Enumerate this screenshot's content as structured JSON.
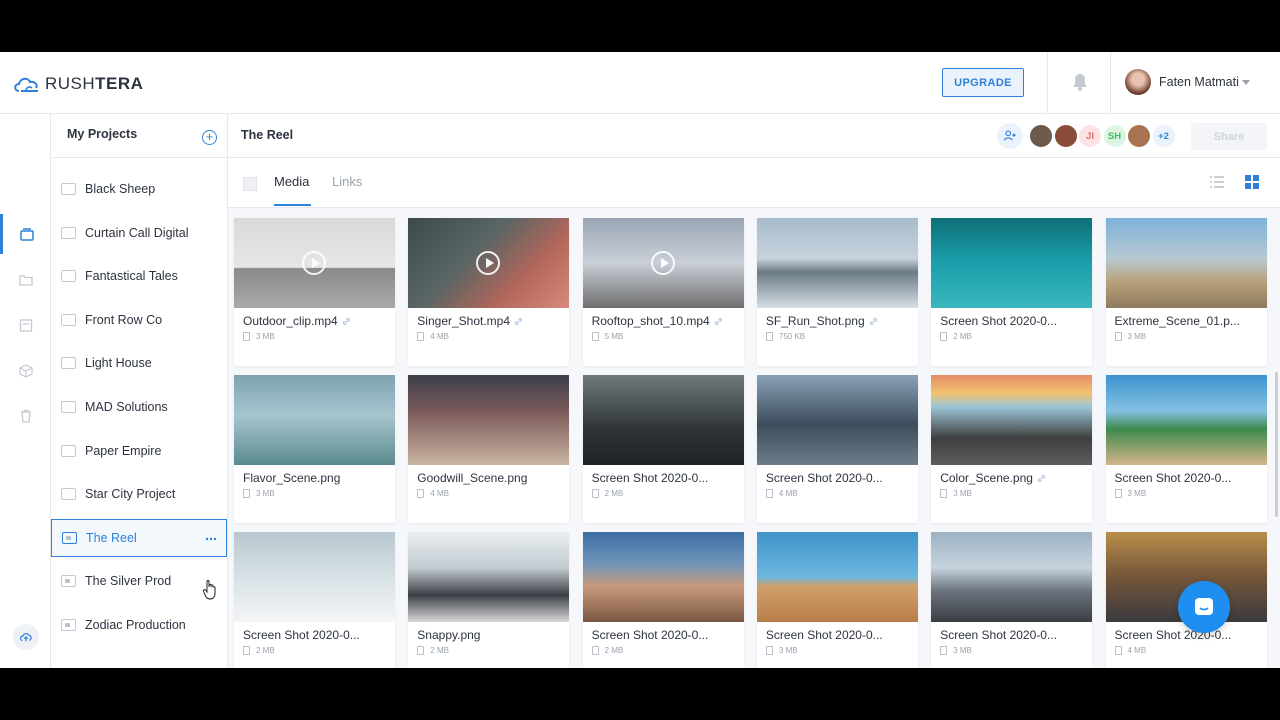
{
  "brand": {
    "name_light": "RUSH",
    "name_bold": "TERA"
  },
  "header": {
    "upgrade_label": "UPGRADE",
    "user_name": "Faten Matmati"
  },
  "projects": {
    "title": "My Projects",
    "items": [
      {
        "label": "Black Sheep",
        "shared": false
      },
      {
        "label": "Curtain Call Digital",
        "shared": false
      },
      {
        "label": "Fantastical Tales",
        "shared": false
      },
      {
        "label": "Front Row Co",
        "shared": false
      },
      {
        "label": "Light House",
        "shared": false
      },
      {
        "label": "MAD Solutions",
        "shared": false
      },
      {
        "label": "Paper Empire",
        "shared": false
      },
      {
        "label": "Star City Project",
        "shared": false
      },
      {
        "label": "The Reel",
        "shared": true
      },
      {
        "label": "The Silver Prod",
        "shared": true
      },
      {
        "label": "Zodiac Production",
        "shared": true
      }
    ],
    "active_index": 8
  },
  "main": {
    "title": "The Reel",
    "collaborators": [
      {
        "initials": "",
        "color": "#6d5a4b"
      },
      {
        "initials": "",
        "color": "#8b4b3a"
      },
      {
        "initials": "JI",
        "color": "#fde2e2",
        "text": "#e66b6b"
      },
      {
        "initials": "SH",
        "color": "#dff5e4",
        "text": "#3dbb62"
      },
      {
        "initials": "",
        "color": "#a8734f"
      },
      {
        "initials": "+2",
        "color": "#eaf3fc",
        "text": "#2f80d9"
      }
    ],
    "share_label": "Share",
    "tabs": [
      {
        "label": "Media"
      },
      {
        "label": "Links"
      }
    ]
  },
  "files": [
    {
      "name": "Outdoor_clip.mp4",
      "size": "3 MB",
      "video": true,
      "link": true
    },
    {
      "name": "Singer_Shot.mp4",
      "size": "4 MB",
      "video": true,
      "link": true
    },
    {
      "name": "Rooftop_shot_10.mp4",
      "size": "5 MB",
      "video": true,
      "link": true
    },
    {
      "name": "SF_Run_Shot.png",
      "size": "750 KB",
      "video": false,
      "link": true
    },
    {
      "name": "Screen Shot 2020-0...",
      "size": "2 MB",
      "video": false,
      "link": false
    },
    {
      "name": "Extreme_Scene_01.p...",
      "size": "3 MB",
      "video": false,
      "link": false
    },
    {
      "name": "Flavor_Scene.png",
      "size": "3 MB",
      "video": false,
      "link": false
    },
    {
      "name": "Goodwill_Scene.png",
      "size": "4 MB",
      "video": false,
      "link": false
    },
    {
      "name": "Screen Shot 2020-0...",
      "size": "2 MB",
      "video": false,
      "link": false
    },
    {
      "name": "Screen Shot 2020-0...",
      "size": "4 MB",
      "video": false,
      "link": false
    },
    {
      "name": "Color_Scene.png",
      "size": "3 MB",
      "video": false,
      "link": true
    },
    {
      "name": "Screen Shot 2020-0...",
      "size": "3 MB",
      "video": false,
      "link": false
    },
    {
      "name": "Screen Shot 2020-0...",
      "size": "2 MB",
      "video": false,
      "link": false
    },
    {
      "name": "Snappy.png",
      "size": "2 MB",
      "video": false,
      "link": false
    },
    {
      "name": "Screen Shot 2020-0...",
      "size": "2 MB",
      "video": false,
      "link": false
    },
    {
      "name": "Screen Shot 2020-0...",
      "size": "3 MB",
      "video": false,
      "link": false
    },
    {
      "name": "Screen Shot 2020-0...",
      "size": "3 MB",
      "video": false,
      "link": false
    },
    {
      "name": "Screen Shot 2020-0...",
      "size": "4 MB",
      "video": false,
      "link": false
    }
  ],
  "colors": {
    "accent": "#2f80d9"
  }
}
